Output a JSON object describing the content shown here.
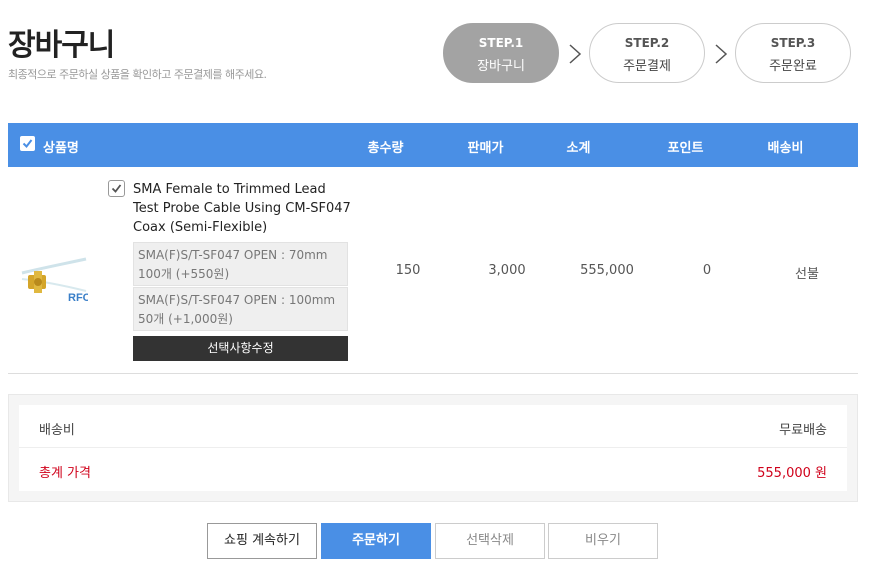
{
  "page": {
    "title": "장바구니",
    "subtitle": "최종적으로 주문하실 상품을 확인하고 주문결제를 해주세요."
  },
  "steps": [
    {
      "num": "STEP.1",
      "name": "장바구니",
      "active": true
    },
    {
      "num": "STEP.2",
      "name": "주문결제",
      "active": false
    },
    {
      "num": "STEP.3",
      "name": "주문완료",
      "active": false
    }
  ],
  "table": {
    "headers": {
      "product": "상품명",
      "quantity": "총수량",
      "price": "판매가",
      "subtotal": "소계",
      "points": "포인트",
      "shipping": "배송비"
    }
  },
  "product": {
    "name": "SMA Female to Trimmed Lead Test Probe Cable Using CM-SF047 Coax (Semi-Flexible)",
    "thumb_text": "RFC",
    "options": [
      "SMA(F)S/T-SF047 OPEN : 70mm 100개 (+550원)",
      "SMA(F)S/T-SF047 OPEN : 100mm 50개 (+1,000원)"
    ],
    "edit_label": "선택사항수정",
    "quantity": "150",
    "price": "3,000",
    "subtotal": "555,000",
    "points": "0",
    "shipping": "선불"
  },
  "summary": {
    "shipping_label": "배송비",
    "shipping_value": "무료배송",
    "total_label": "총계 가격",
    "total_value": "555,000 원"
  },
  "buttons": {
    "continue_shopping": "쇼핑 계속하기",
    "order": "주문하기",
    "delete_selected": "선택삭제",
    "empty": "비우기"
  },
  "colors": {
    "accent": "#4a8fe5",
    "step_active": "#a3a3a3",
    "total_red": "#d0021b"
  }
}
